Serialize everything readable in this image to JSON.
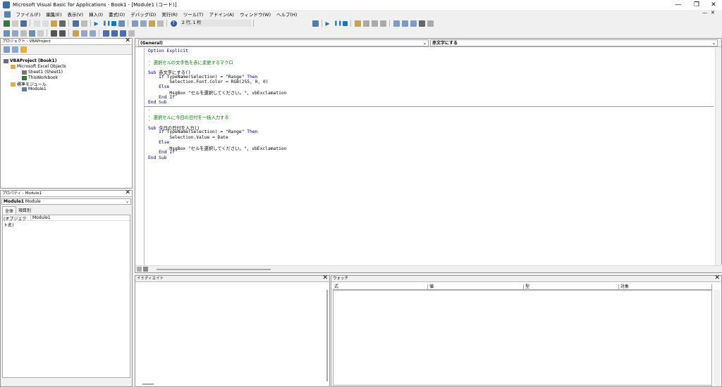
{
  "window": {
    "title": "Microsoft Visual Basic for Applications - Book1 - [Module1 (コード)]"
  },
  "window_controls": {
    "minimize": "—",
    "maximize": "❐",
    "close": "✕"
  },
  "menus": [
    "ファイル(F)",
    "編集(E)",
    "表示(V)",
    "挿入(I)",
    "書式(O)",
    "デバッグ(D)",
    "実行(R)",
    "ツール(T)",
    "アドイン(A)",
    "ウィンドウ(W)",
    "ヘルプ(H)"
  ],
  "toolbar": {
    "position_text": "2 行, 1 桁"
  },
  "project_pane": {
    "title": "プロジェクト - VBAProject",
    "tree": [
      {
        "label": "VBAProject (Book1)",
        "level": 0
      },
      {
        "label": "Microsoft Excel Objects",
        "level": 1
      },
      {
        "label": "Sheet1 (Sheet1)",
        "level": 2
      },
      {
        "label": "ThisWorkbook",
        "level": 2
      },
      {
        "label": "標準モジュール",
        "level": 1
      },
      {
        "label": "Module1",
        "level": 2
      }
    ]
  },
  "properties_pane": {
    "title": "プロパティ - Module1",
    "object_name": "Module1",
    "object_type": "Module",
    "tabs": [
      "全体",
      "項目別"
    ],
    "prop_name": "(オブジェクト名)",
    "prop_value": "Module1"
  },
  "code_window": {
    "object_combo": "(General)",
    "proc_combo": "赤文字にする",
    "lines_block1": [
      {
        "t": "Option Explicit",
        "c": "kw"
      },
      {
        "t": "'",
        "c": "cm"
      },
      {
        "t": "' 選択セルの文字色を赤に変更するマクロ",
        "c": "cm"
      },
      {
        "t": "'",
        "c": "cm"
      },
      {
        "t": "Sub 赤文字にする()",
        "c": ""
      },
      {
        "t": "    If TypeName(Selection) = \"Range\" Then",
        "c": ""
      },
      {
        "t": "        Selection.Font.Color = RGB(255, 0, 0)",
        "c": ""
      },
      {
        "t": "    Else",
        "c": ""
      },
      {
        "t": "        MsgBox \"セルを選択してください。\", vbExclamation",
        "c": ""
      },
      {
        "t": "    End If",
        "c": ""
      },
      {
        "t": "End Sub",
        "c": ""
      }
    ],
    "lines_block2": [
      {
        "t": "'",
        "c": "cm"
      },
      {
        "t": "' 選択セルに今日の日付を一括入力する",
        "c": "cm"
      },
      {
        "t": "'",
        "c": "cm"
      },
      {
        "t": "Sub 今日の日付を入力()",
        "c": ""
      },
      {
        "t": "    If TypeName(Selection) = \"Range\" Then",
        "c": ""
      },
      {
        "t": "        Selection.Value = Date",
        "c": ""
      },
      {
        "t": "    Else",
        "c": ""
      },
      {
        "t": "        MsgBox \"セルを選択してください。\", vbExclamation",
        "c": ""
      },
      {
        "t": "    End If",
        "c": ""
      },
      {
        "t": "End Sub",
        "c": ""
      }
    ]
  },
  "immediate_pane": {
    "title": "イミディエイト"
  },
  "watch_pane": {
    "title": "ウォッチ",
    "columns": [
      "式",
      "値",
      "型",
      "対象"
    ]
  },
  "colors": {
    "keyword": "#00008b",
    "comment": "#008000",
    "title_bg": "#ffffff"
  }
}
